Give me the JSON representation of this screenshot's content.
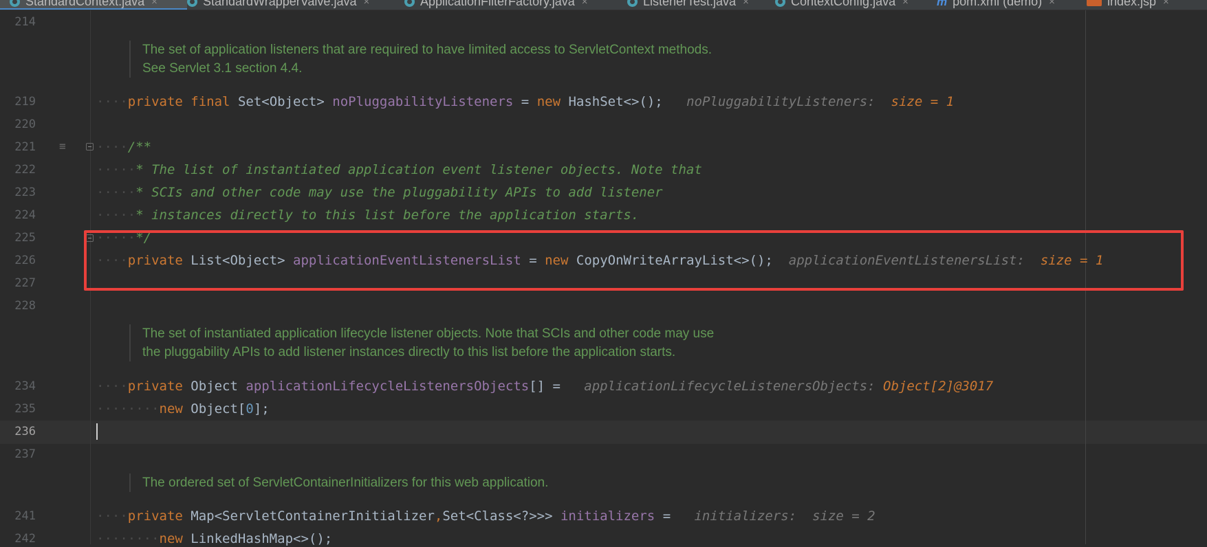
{
  "tabs": [
    {
      "label": "StandardContext.java",
      "icon": "class-icon",
      "active": true
    },
    {
      "label": "StandardWrapperValve.java",
      "icon": "class-icon"
    },
    {
      "label": "ApplicationFilterFactory.java",
      "icon": "class-icon"
    },
    {
      "label": "ListenerTest.java",
      "icon": "class-icon"
    },
    {
      "label": "ContextConfig.java",
      "icon": "class-icon"
    },
    {
      "label": "pom.xml (demo)",
      "icon": "maven-icon"
    },
    {
      "label": "index.jsp",
      "icon": "jsp-icon"
    }
  ],
  "jsp_icon_text": "JSP",
  "close_glyph": "×",
  "line_numbers": {
    "l214": "214",
    "l219": "219",
    "l220": "220",
    "l221": "221",
    "l222": "222",
    "l223": "223",
    "l224": "224",
    "l225": "225",
    "l226": "226",
    "l227": "227",
    "l228": "228",
    "l234": "234",
    "l235": "235",
    "l236": "236",
    "l237": "237",
    "l241": "241",
    "l242": "242"
  },
  "docs": {
    "d1_line1": "The set of application listeners that are required to have limited access to ServletContext methods.",
    "d1_line2": "See Servlet 3.1 section 4.4.",
    "d2_line1": "The set of instantiated application lifecycle listener objects. Note that SCIs and other code may use",
    "d2_line2": "the pluggability APIs to add listener instances directly to this list before the application starts.",
    "d3_line1": "The ordered set of ServletContainerInitializers for this web application."
  },
  "code": {
    "dots4": "····",
    "dots8": "········",
    "dots5": "·····",
    "private": "private",
    "final": "final",
    "new": "new",
    "l219_type": "Set<Object>",
    "l219_field": "noPluggabilityListeners",
    "eq": " = ",
    "l219_ctor": "HashSet<>();",
    "l219_hint_name": "noPluggabilityListeners:",
    "l219_hint_val": "size = 1",
    "l221": "/**",
    "l222": "* The list of instantiated application event listener objects. Note that",
    "l223": "* SCIs and other code may use the pluggability APIs to add listener",
    "l224": "* instances directly to this list before the application starts.",
    "l225": "*/",
    "l226_type": "List<Object>",
    "l226_field": "applicationEventListenersList",
    "l226_ctor": "CopyOnWriteArrayList<>();",
    "l226_hint_name": "applicationEventListenersList:",
    "l226_hint_val": "size = 1",
    "l234_type": "Object",
    "l234_field": "applicationLifecycleListenersObjects",
    "l234_tail": "[] =",
    "l234_hint_name": "applicationLifecycleListenersObjects:",
    "l234_hint_val": "Object[2]@3017",
    "l235_type": "Object[",
    "l235_num": "0",
    "l235_tail": "];",
    "l241_type": "Map<ServletContainerInitializer",
    "l241_comma": ",",
    "l241_type2": "Set<Class<?>>>",
    "l241_field": "initializers",
    "l241_eq": " =",
    "l241_hint_name": "initializers:",
    "l241_hint_val": "size = 2",
    "l242_ctor": "LinkedHashMap<>();"
  }
}
